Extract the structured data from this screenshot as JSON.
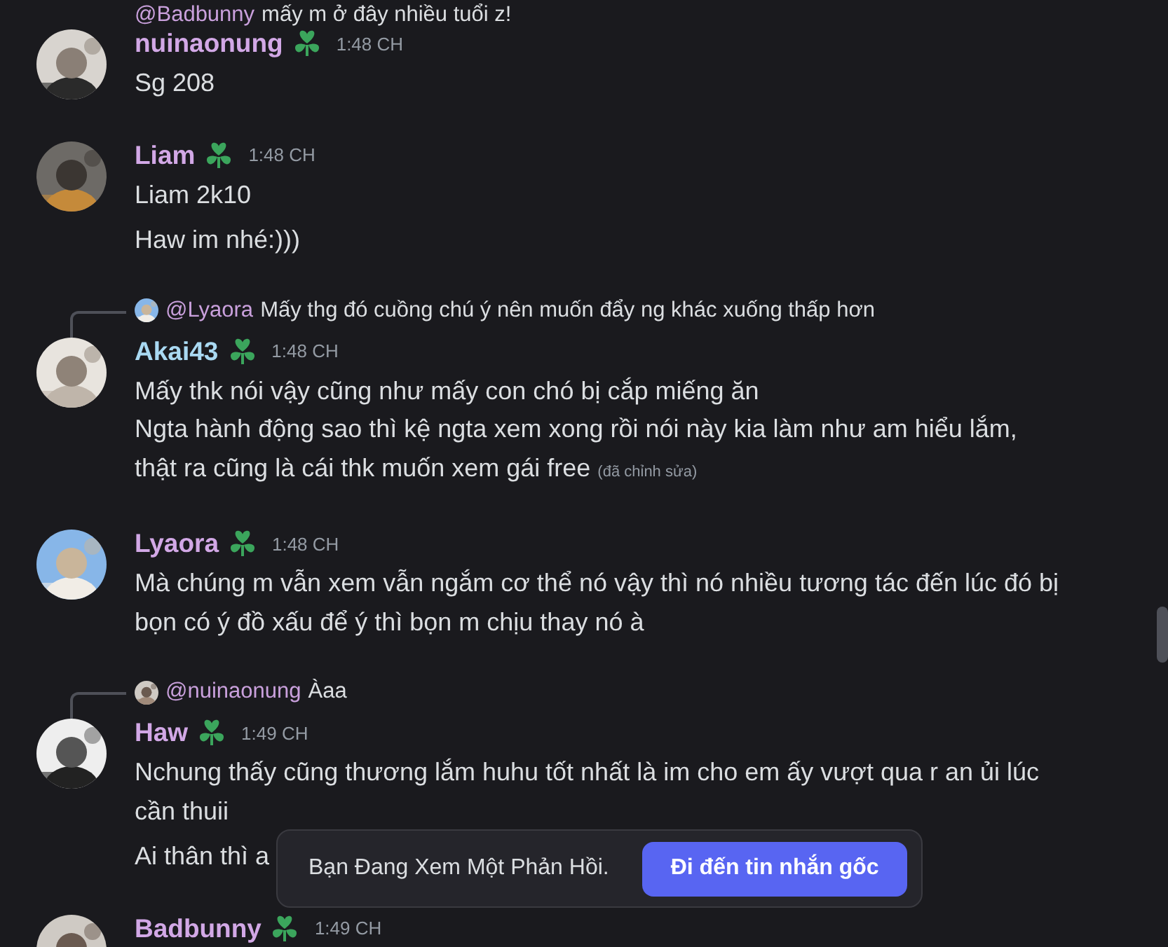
{
  "top_reply": {
    "mention": "@Badbunny",
    "text": "mấy m ở đây nhiều tuổi z!"
  },
  "messages": [
    {
      "author": "nuinaonung",
      "color": "#d2a8e6",
      "time": "1:48 CH",
      "blocks": [
        "Sg 208"
      ]
    },
    {
      "author": "Liam",
      "color": "#d2a8e6",
      "time": "1:48 CH",
      "blocks": [
        "Liam 2k10",
        "Haw im nhé:)))"
      ]
    },
    {
      "author": "Akai43",
      "color": "#a9d9f2",
      "time": "1:48 CH",
      "reply": {
        "mention": "@Lyaora",
        "text": "Mấy thg đó cuồng chú ý nên muốn đẩy ng khác xuống thấp hơn"
      },
      "blocks": [
        "Mấy thk nói vậy cũng như mấy con chó bị cắp miếng ăn\nNgta hành động sao thì kệ ngta xem xong rồi nói này kia làm như am hiểu lắm, thật ra cũng là cái thk muốn xem gái free"
      ],
      "edited": "(đã chỉnh sửa)"
    },
    {
      "author": "Lyaora",
      "color": "#d2a8e6",
      "time": "1:48 CH",
      "blocks": [
        "Mà chúng m vẫn xem vẫn ngắm cơ thể nó vậy thì nó nhiều tương tác đến lúc đó bị bọn có ý đồ xấu để ý thì bọn m chịu thay nó à"
      ]
    },
    {
      "author": "Haw",
      "color": "#d2a8e6",
      "time": "1:49 CH",
      "reply": {
        "mention": "@nuinaonung",
        "text": "Àaa"
      },
      "blocks": [
        "Nchung thấy cũng thương lắm huhu tốt nhất là im cho em ấy vượt qua r an ủi lúc cần thuii",
        "Ai thân thì a"
      ]
    },
    {
      "author": "Badbunny",
      "color": "#d2a8e6",
      "time": "1:49 CH"
    }
  ],
  "toast": {
    "text": "Bạn Đang Xem Một Phản Hồi.",
    "button": "Đi đến tin nhắn gốc"
  }
}
